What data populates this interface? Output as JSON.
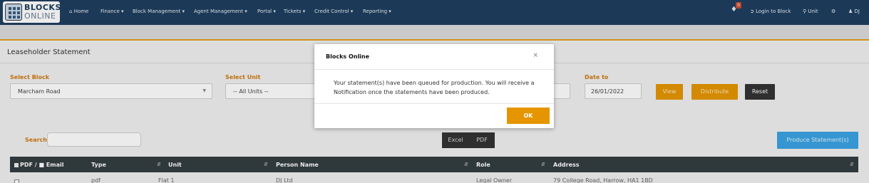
{
  "nav": {
    "logo_line1": "BLOCKS",
    "logo_line2": "ONLINE",
    "items": [
      {
        "label": "Home",
        "icon": "home-icon"
      },
      {
        "label": "Finance ▾"
      },
      {
        "label": "Block Management ▾"
      },
      {
        "label": "Agent Management ▾"
      },
      {
        "label": "Portal ▾"
      },
      {
        "label": "Tickets ▾"
      },
      {
        "label": "Credit Control ▾"
      },
      {
        "label": "Reporting ▾"
      }
    ],
    "notification_count": "0",
    "login_to_block": "Login to Block",
    "unit": "Unit",
    "user": "DJ"
  },
  "page": {
    "title": "Leaseholder Statement"
  },
  "filters": {
    "select_block_label": "Select Block",
    "select_block_value": "Marcham Road",
    "select_unit_label": "Select Unit",
    "select_unit_value": "-- All Units --",
    "date_to_label": "Date to",
    "date_to_value": "26/01/2022",
    "view_label": "View",
    "distribute_label": "Distribute",
    "reset_label": "Reset"
  },
  "table": {
    "search_label": "Search:",
    "export_excel": "Excel",
    "export_pdf": "PDF",
    "produce_label": "Produce Statement(s)",
    "headers": {
      "pdf_email": "PDF / ■ Email",
      "type": "Type",
      "unit": "Unit",
      "person_name": "Person Name",
      "role": "Role",
      "address": "Address"
    },
    "rows": [
      {
        "type": "pdf",
        "unit": "Flat 1",
        "person_name": "DJ Ltd",
        "role": "Legal Owner",
        "address": "79 College Road, Harrow, HA1 1BD"
      }
    ]
  },
  "modal": {
    "title": "Blocks Online",
    "close": "×",
    "message": "Your statement(s) have been queued for production. You will receive a Notification once the statements have been produced.",
    "ok_label": "OK"
  },
  "colors": {
    "navbar": "#1f3f60",
    "accent_orange": "#e59500",
    "label_orange": "#d07a10",
    "table_header": "#333d3f",
    "produce_blue": "#3aa3e3"
  }
}
